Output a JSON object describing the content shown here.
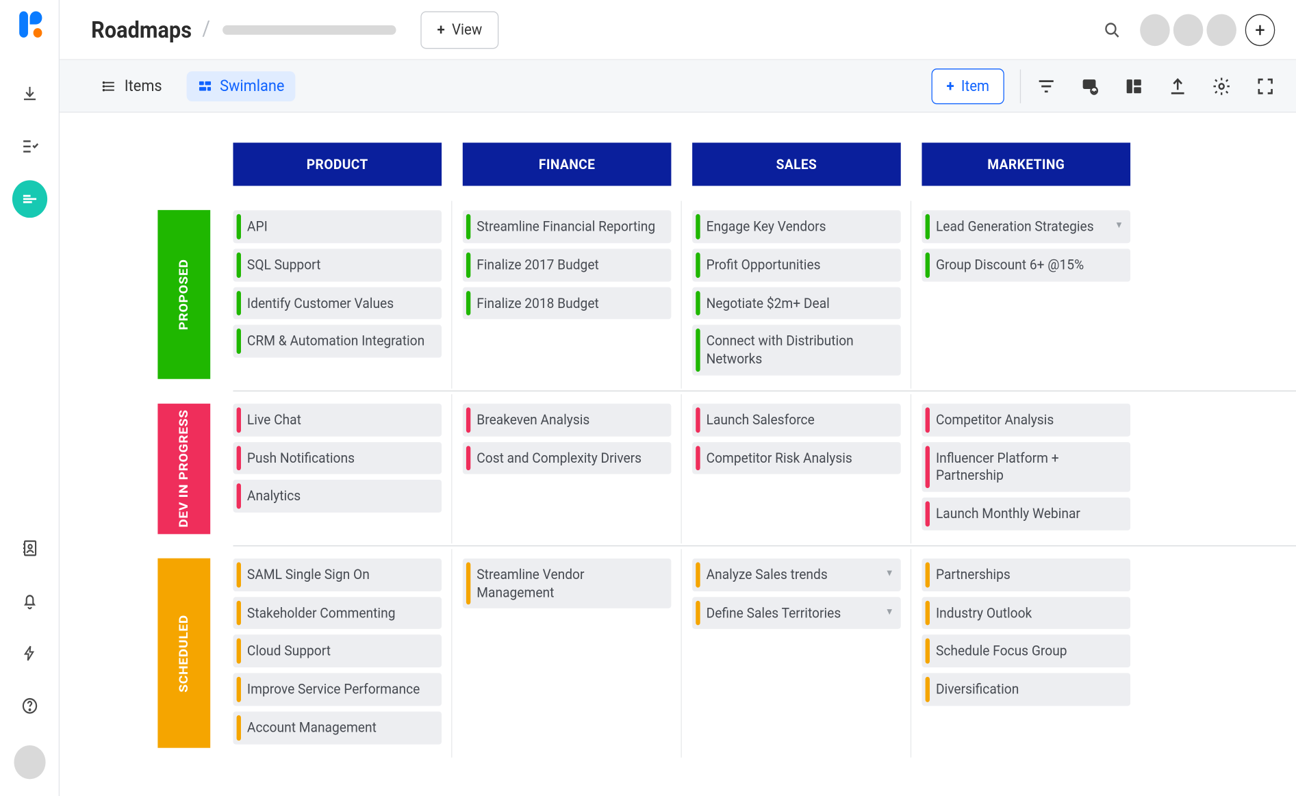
{
  "header": {
    "title": "Roadmaps",
    "view_button": "View",
    "search_icon": "search-icon",
    "add_icon": "+"
  },
  "toolbar": {
    "items_label": "Items",
    "swimlane_label": "Swimlane",
    "add_item_label": "Item",
    "icons": [
      "filter-icon",
      "link-card-icon",
      "panel-icon",
      "export-icon",
      "gear-icon",
      "fullscreen-icon"
    ]
  },
  "columns": [
    "PRODUCT",
    "FINANCE",
    "SALES",
    "MARKETING"
  ],
  "lanes": [
    {
      "key": "proposed",
      "label": "PROPOSED",
      "color": "#1fb700",
      "cells": [
        [
          "API",
          "SQL Support",
          "Identify Customer Values",
          "CRM & Automation Integration"
        ],
        [
          "Streamline Financial Reporting",
          "Finalize 2017 Budget",
          "Finalize 2018 Budget"
        ],
        [
          "Engage Key Vendors",
          "Profit Opportunities",
          "Negotiate $2m+ Deal",
          "Connect with Distribution Networks"
        ],
        [
          "Lead Generation Strategies",
          "Group Discount 6+ @15%"
        ]
      ],
      "chevrons": {
        "3": [
          0
        ]
      }
    },
    {
      "key": "dev",
      "label": "DEV IN PROGRESS",
      "color": "#ef2e5b",
      "cells": [
        [
          "Live Chat",
          "Push Notifications",
          "Analytics"
        ],
        [
          "Breakeven Analysis",
          "Cost and Complexity Drivers"
        ],
        [
          "Launch Salesforce",
          "Competitor Risk Analysis"
        ],
        [
          "Competitor Analysis",
          "Influencer Platform + Partnership",
          "Launch Monthly Webinar"
        ]
      ],
      "chevrons": {}
    },
    {
      "key": "scheduled",
      "label": "SCHEDULED",
      "color": "#f5a500",
      "cells": [
        [
          "SAML Single Sign On",
          "Stakeholder Commenting",
          "Cloud Support",
          "Improve Service Performance",
          "Account Management"
        ],
        [
          "Streamline Vendor Management"
        ],
        [
          "Analyze Sales trends",
          "Define Sales Territories"
        ],
        [
          "Partnerships",
          "Industry Outlook",
          "Schedule Focus Group",
          "Diversification"
        ]
      ],
      "chevrons": {
        "2": [
          0,
          1
        ]
      }
    }
  ]
}
